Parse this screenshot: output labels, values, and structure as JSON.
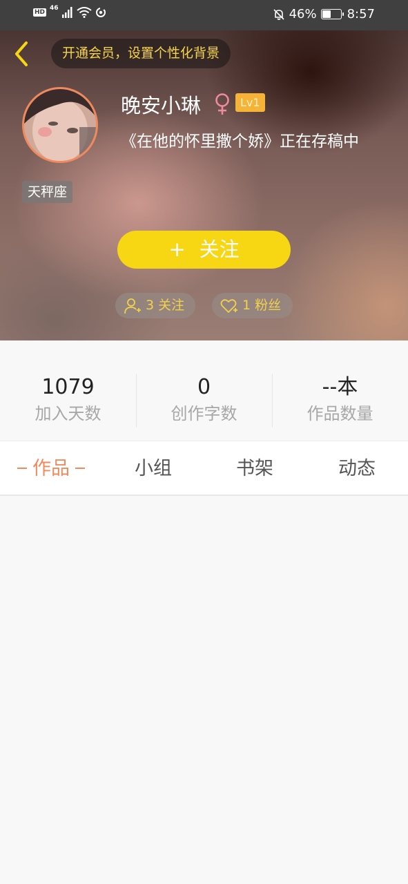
{
  "status_bar": {
    "left_badge": "HD",
    "network_type": "46",
    "battery_percent": "46%",
    "battery_level": 0.46,
    "time": "8:57",
    "icons": [
      "signal-icon",
      "wifi-icon",
      "sync-icon",
      "mute-bell-icon",
      "battery-icon"
    ]
  },
  "header": {
    "back_icon": "back-chevron-icon",
    "vip_prompt": "开通会员，设置个性化背景",
    "username": "晚安小琳",
    "gender_symbol": "♀",
    "level": "Lv1",
    "writing_status": "《在他的怀里撒个娇》正在存稿中",
    "zodiac": "天秤座",
    "follow_button": {
      "icon": "+",
      "label": "关注"
    },
    "following": {
      "icon": "user-add-icon",
      "label": "3 关注"
    },
    "fans": {
      "icon": "heart-icon",
      "label": "1 粉丝"
    },
    "colors": {
      "accent_yellow": "#f7d613",
      "accent_orange": "#f08a5d",
      "level_badge": "#f5b338"
    }
  },
  "stats": [
    {
      "value": "1079",
      "label": "加入天数"
    },
    {
      "value": "0",
      "label": "创作字数"
    },
    {
      "value": "--本",
      "label": "作品数量"
    }
  ],
  "tabs": [
    {
      "label": "作品",
      "active": true
    },
    {
      "label": "小组",
      "active": false
    },
    {
      "label": "书架",
      "active": false
    },
    {
      "label": "动态",
      "active": false
    }
  ]
}
